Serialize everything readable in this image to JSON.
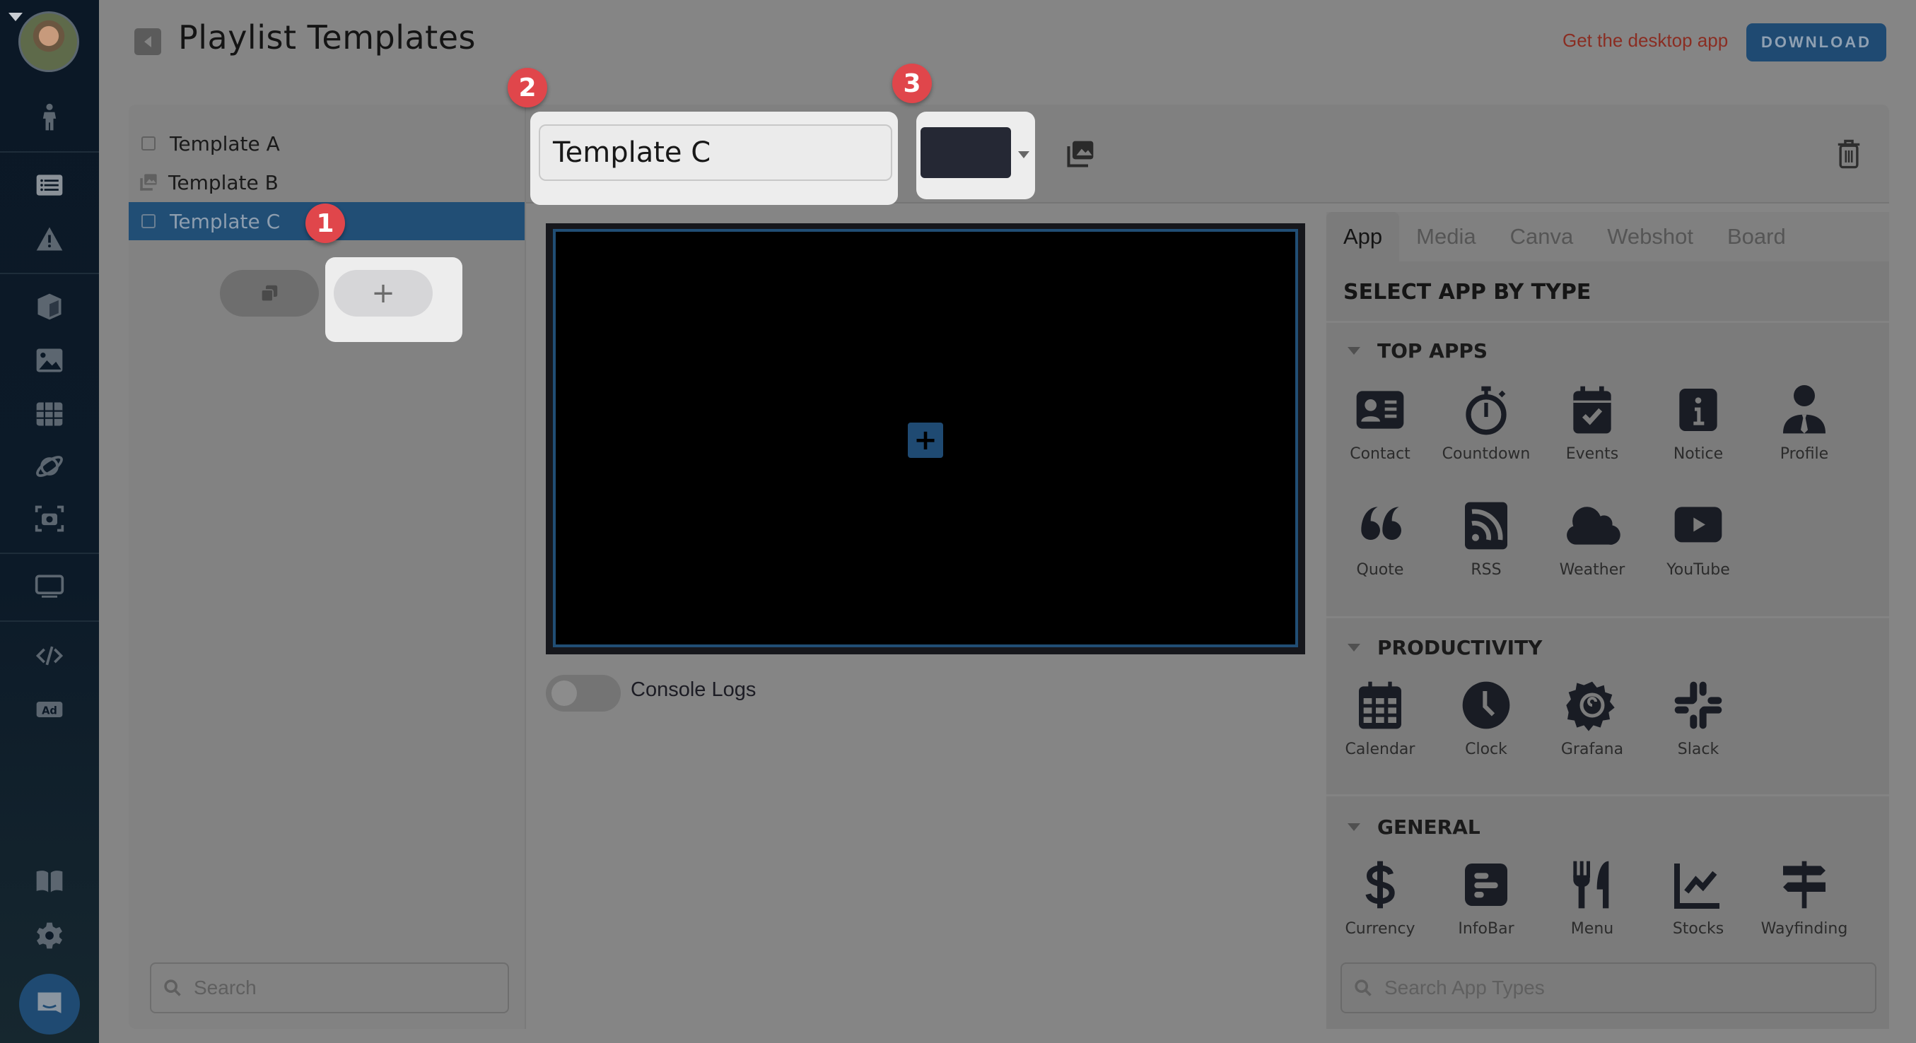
{
  "header": {
    "title": "Playlist Templates",
    "desktop_link": "Get the desktop app",
    "download_label": "DOWNLOAD"
  },
  "sidebar": {
    "icons": [
      "user-icon",
      "playlist-icon",
      "alert-icon",
      "cube-icon",
      "image-icon",
      "grid-icon",
      "planet-icon",
      "screenshot-icon",
      "monitor-icon",
      "code-icon",
      "ad-icon",
      "book-icon",
      "settings-icon",
      "chat-icon"
    ]
  },
  "templates": [
    {
      "label": "Template A",
      "icon": "checkbox",
      "selected": false
    },
    {
      "label": "Template B",
      "icon": "media-stack",
      "selected": false
    },
    {
      "label": "Template C",
      "icon": "checkbox",
      "selected": true
    }
  ],
  "template_actions": {
    "duplicate": "duplicate-icon",
    "add": "+"
  },
  "badges": [
    "1",
    "2",
    "3"
  ],
  "editor": {
    "name_value": "Template C",
    "background_color": "#252834",
    "canvas_add": "+",
    "console_logs_label": "Console Logs",
    "console_logs_enabled": false
  },
  "left_search": {
    "placeholder": "Search"
  },
  "app_panel": {
    "tabs": [
      "App",
      "Media",
      "Canva",
      "Webshot",
      "Board"
    ],
    "active_tab": "App",
    "title": "SELECT APP BY TYPE",
    "groups": [
      {
        "name": "TOP APPS",
        "apps": [
          "Contact",
          "Countdown",
          "Events",
          "Notice",
          "Profile",
          "Quote",
          "RSS",
          "Weather",
          "YouTube"
        ]
      },
      {
        "name": "PRODUCTIVITY",
        "apps": [
          "Calendar",
          "Clock",
          "Grafana",
          "Slack"
        ]
      },
      {
        "name": "GENERAL",
        "apps": [
          "Currency",
          "InfoBar",
          "Menu",
          "Stocks",
          "Wayfinding"
        ]
      }
    ],
    "search_placeholder": "Search App Types"
  },
  "colors": {
    "accent": "#1f4a72",
    "badge": "#e0464b",
    "link": "#8a2d22"
  }
}
